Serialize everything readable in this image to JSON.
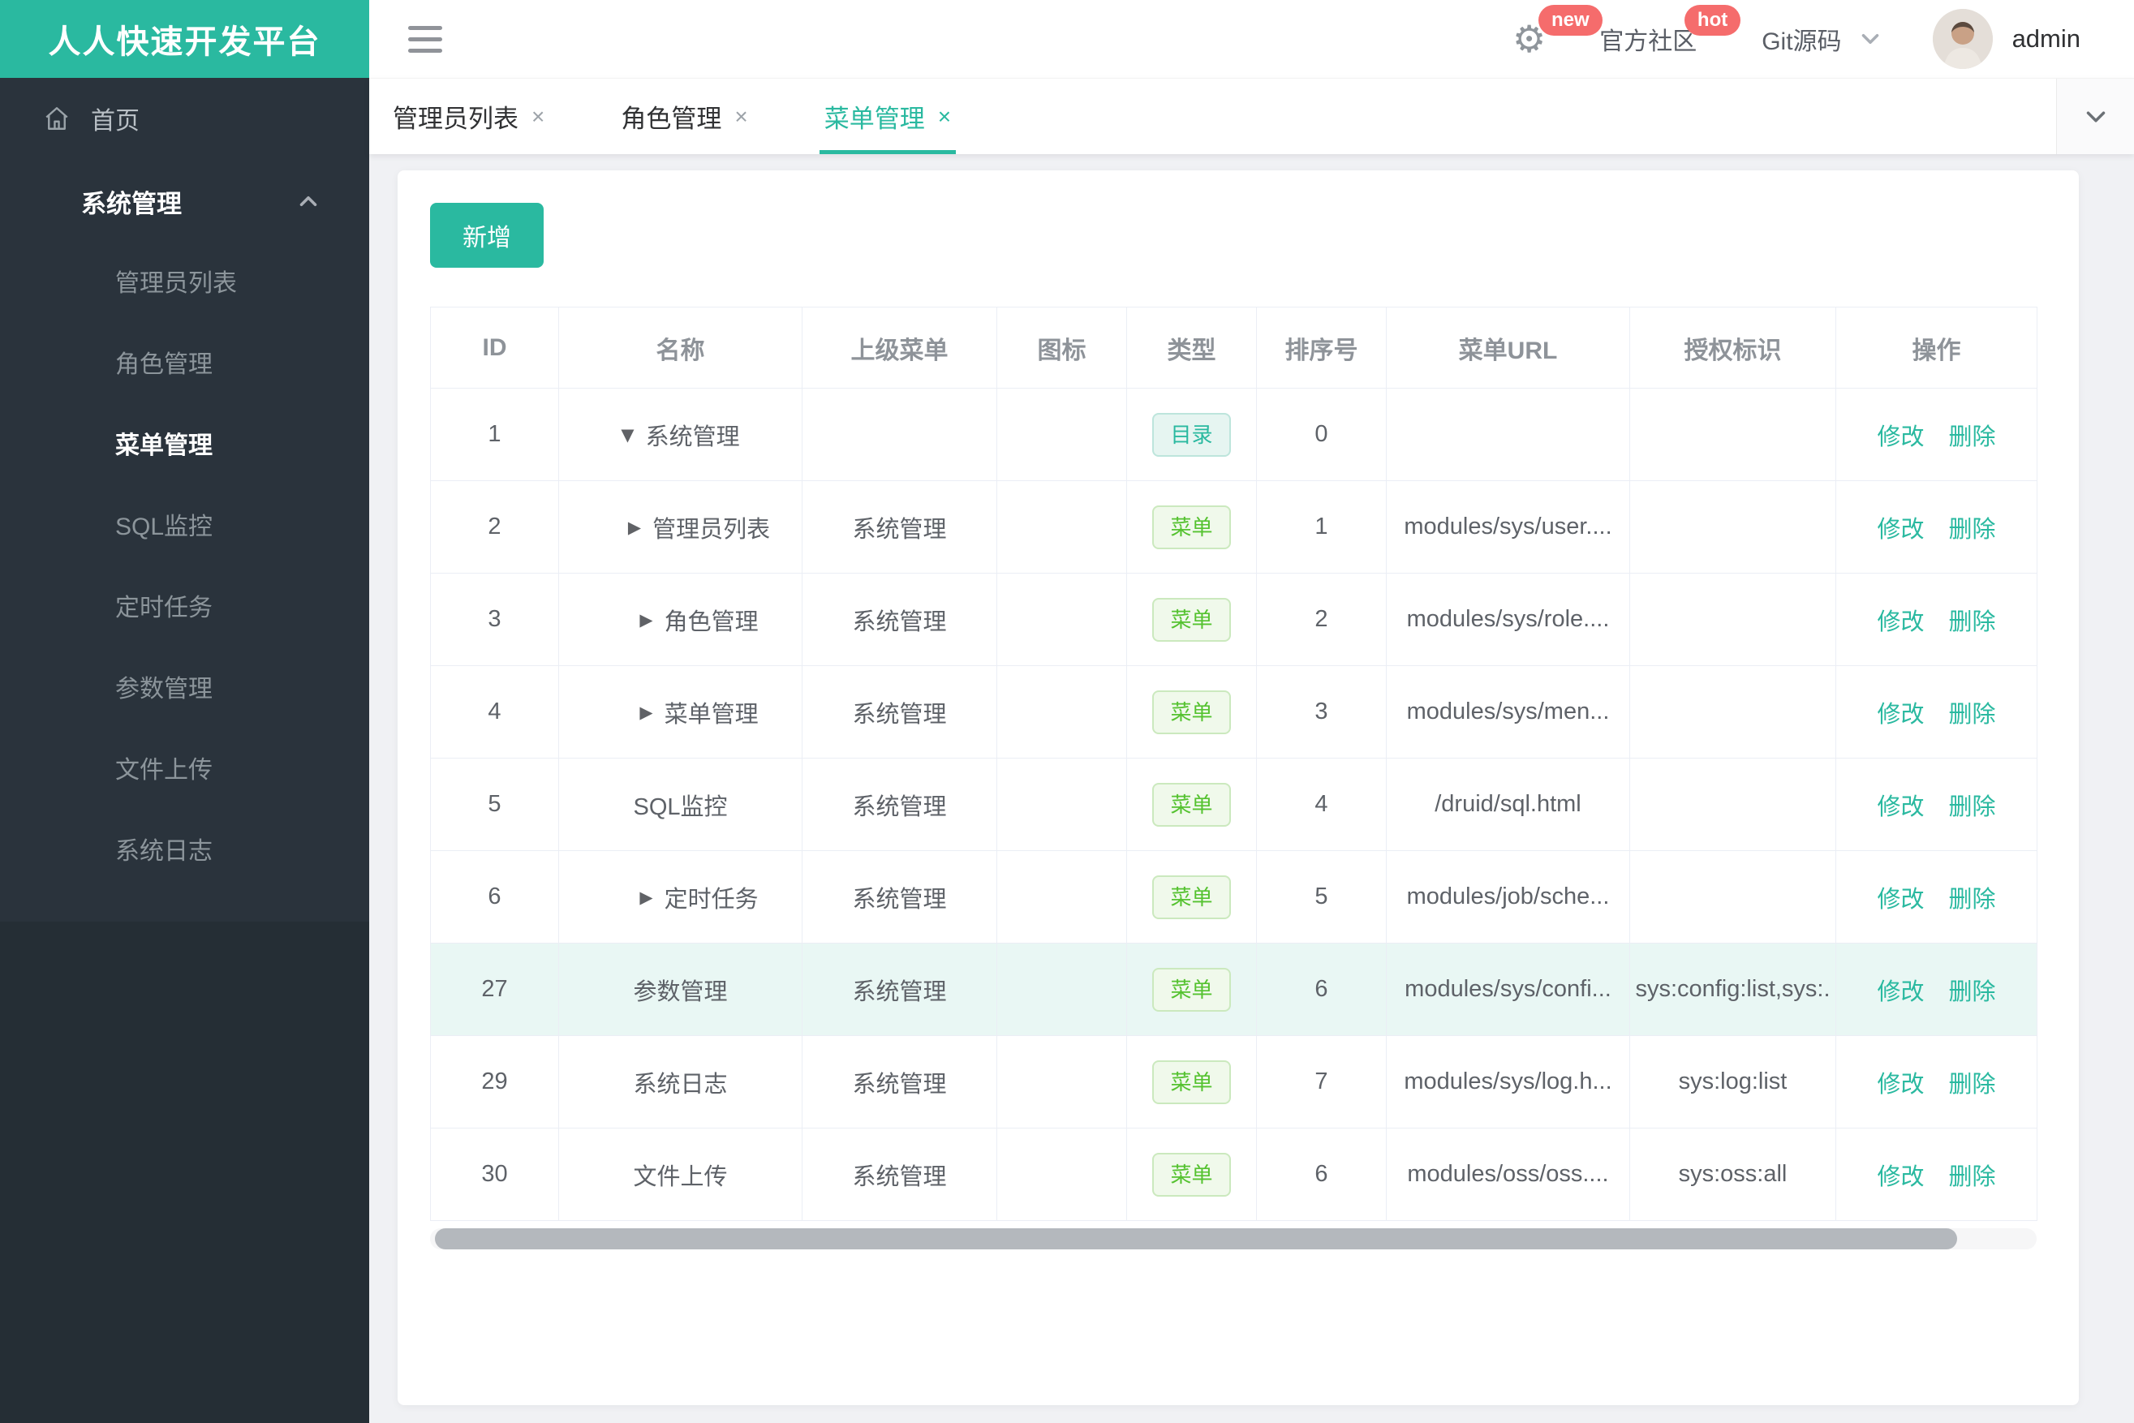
{
  "app": {
    "title": "人人快速开发平台"
  },
  "header": {
    "new_badge": "new",
    "community_label": "官方社区",
    "hot_badge": "hot",
    "git_label": "Git源码",
    "username": "admin"
  },
  "sidebar": {
    "home_label": "首页",
    "group": {
      "label": "系统管理",
      "items": [
        "管理员列表",
        "角色管理",
        "菜单管理",
        "SQL监控",
        "定时任务",
        "参数管理",
        "文件上传",
        "系统日志"
      ],
      "active_item": "菜单管理"
    }
  },
  "tabs": [
    {
      "label": "管理员列表",
      "active": false
    },
    {
      "label": "角色管理",
      "active": false
    },
    {
      "label": "菜单管理",
      "active": true
    }
  ],
  "toolbar": {
    "add_label": "新增"
  },
  "table": {
    "columns": [
      "ID",
      "名称",
      "上级菜单",
      "图标",
      "类型",
      "排序号",
      "菜单URL",
      "授权标识",
      "操作"
    ],
    "type_badges": {
      "dir": "目录",
      "menu": "菜单"
    },
    "actions": {
      "edit": "修改",
      "delete": "删除"
    },
    "rows": [
      {
        "id": "1",
        "name": "系统管理",
        "arrow": "down",
        "parent": "",
        "type": "dir",
        "order": "0",
        "url": "",
        "perms": "",
        "highlight": false
      },
      {
        "id": "2",
        "name": "管理员列表",
        "arrow": "right",
        "parent": "系统管理",
        "type": "menu",
        "order": "1",
        "url": "modules/sys/user....",
        "perms": "",
        "highlight": false
      },
      {
        "id": "3",
        "name": "角色管理",
        "arrow": "right",
        "parent": "系统管理",
        "type": "menu",
        "order": "2",
        "url": "modules/sys/role....",
        "perms": "",
        "highlight": false
      },
      {
        "id": "4",
        "name": "菜单管理",
        "arrow": "right",
        "parent": "系统管理",
        "type": "menu",
        "order": "3",
        "url": "modules/sys/men...",
        "perms": "",
        "highlight": false
      },
      {
        "id": "5",
        "name": "SQL监控",
        "arrow": "none",
        "parent": "系统管理",
        "type": "menu",
        "order": "4",
        "url": "/druid/sql.html",
        "perms": "",
        "highlight": false
      },
      {
        "id": "6",
        "name": "定时任务",
        "arrow": "right",
        "parent": "系统管理",
        "type": "menu",
        "order": "5",
        "url": "modules/job/sche...",
        "perms": "",
        "highlight": false
      },
      {
        "id": "27",
        "name": "参数管理",
        "arrow": "none",
        "parent": "系统管理",
        "type": "menu",
        "order": "6",
        "url": "modules/sys/confi...",
        "perms": "sys:config:list,sys:.",
        "highlight": true
      },
      {
        "id": "29",
        "name": "系统日志",
        "arrow": "none",
        "parent": "系统管理",
        "type": "menu",
        "order": "7",
        "url": "modules/sys/log.h...",
        "perms": "sys:log:list",
        "highlight": false
      },
      {
        "id": "30",
        "name": "文件上传",
        "arrow": "none",
        "parent": "系统管理",
        "type": "menu",
        "order": "6",
        "url": "modules/oss/oss....",
        "perms": "sys:oss:all",
        "highlight": false
      }
    ]
  },
  "icons": {
    "caret_down": "▼",
    "caret_right": "▶",
    "close": "×",
    "gear": "⚙"
  },
  "colors": {
    "accent": "#2AB9A0",
    "danger": "#F56C6C",
    "menu_green": "#55C230",
    "row_highlight": "#E9F7F4",
    "sidebar_dark": "#252E35",
    "sidebar_menu": "#2A333C"
  }
}
